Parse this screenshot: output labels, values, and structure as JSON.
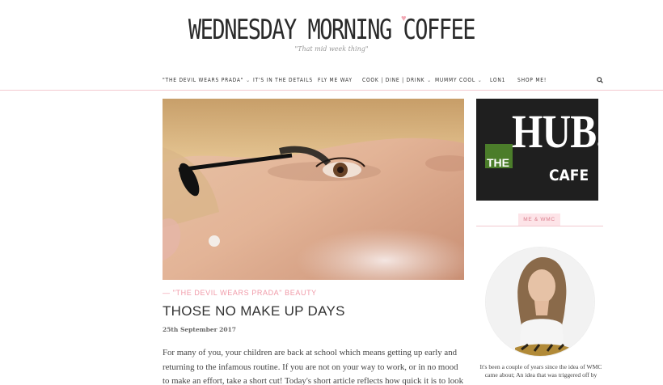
{
  "header": {
    "logo": "WEDNESDAY MORNING COFFEE",
    "tagline": "\"That mid week thing\""
  },
  "nav": {
    "items": [
      {
        "label": "\"THE DEVIL WEARS PRADA\"",
        "has_dropdown": true
      },
      {
        "label": "IT'S IN THE DETAILS",
        "has_dropdown": false
      },
      {
        "label": "FLY ME WAY",
        "has_dropdown": false
      },
      {
        "label": "COOK | DINE | DRINK",
        "has_dropdown": true
      },
      {
        "label": "MUMMY COOL",
        "has_dropdown": true
      },
      {
        "label": "LON1",
        "has_dropdown": false
      },
      {
        "label": "SHOP ME!",
        "has_dropdown": false
      }
    ],
    "search_icon": "search-icon"
  },
  "post": {
    "categories": "— \"THE DEVIL WEARS PRADA\" BEAUTY",
    "title": "THOSE NO MAKE UP DAYS",
    "date": "25th September 2017",
    "excerpt": "For many of you, your children are back at school which means getting up early and returning to the infamous routine. If you are not on your way to work, or in no mood to make an effort, take a short cut! Today's short article reflects how quick it is to look just as good without going"
  },
  "sidebar": {
    "ad": {
      "the": "THE",
      "hub": "HUB.",
      "cafe": "CAFE"
    },
    "widget_title": "ME & WMC",
    "bio": "It's been a couple of years since the idea of WMC came about; An idea that was triggered off by"
  },
  "colors": {
    "accent_pink": "#f09aa8",
    "ad_background": "#1f1f1f",
    "ad_green": "#4b7d2a"
  }
}
